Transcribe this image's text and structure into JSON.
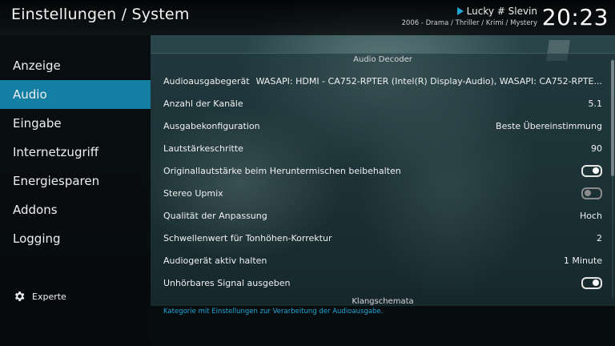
{
  "header": {
    "title": "Einstellungen / System",
    "now_playing_title": "Lucky # Slevin",
    "now_playing_meta": "2006 - Drama / Thriller / Krimi / Mystery",
    "clock": "20:23"
  },
  "sidebar": {
    "items": [
      {
        "label": "Anzeige"
      },
      {
        "label": "Audio",
        "active": true
      },
      {
        "label": "Eingabe"
      },
      {
        "label": "Internetzugriff"
      },
      {
        "label": "Energiesparen"
      },
      {
        "label": "Addons"
      },
      {
        "label": "Logging"
      }
    ],
    "level_label": "Experte"
  },
  "main": {
    "section_title": "Audio Decoder",
    "next_section_title": "Klangschemata",
    "settings": [
      {
        "label": "Audioausgabegerät",
        "value": "WASAPI: HDMI - CA752-RPTER  (Intel(R) Display-Audio), WASAPI: CA752-RPTE..."
      },
      {
        "label": "Anzahl der Kanäle",
        "value": "5.1"
      },
      {
        "label": "Ausgabekonfiguration",
        "value": "Beste Übereinstimmung"
      },
      {
        "label": "Lautstärkeschritte",
        "value": "90"
      },
      {
        "label": "Originallautstärke beim Heruntermischen beibehalten",
        "toggle": "on"
      },
      {
        "label": "Stereo Upmix",
        "toggle": "off"
      },
      {
        "label": "Qualität der Anpassung",
        "value": "Hoch"
      },
      {
        "label": "Schwellenwert für Tonhöhen-Korrektur",
        "value": "2"
      },
      {
        "label": "Audiogerät aktiv halten",
        "value": "1 Minute"
      },
      {
        "label": "Unhörbares Signal ausgeben",
        "toggle": "on"
      }
    ]
  },
  "footer": {
    "description": "Kategorie mit Einstellungen zur Verarbeitung der Audioausgabe."
  },
  "colors": {
    "accent": "#157ea3",
    "footer_text": "#1fa7d6"
  }
}
